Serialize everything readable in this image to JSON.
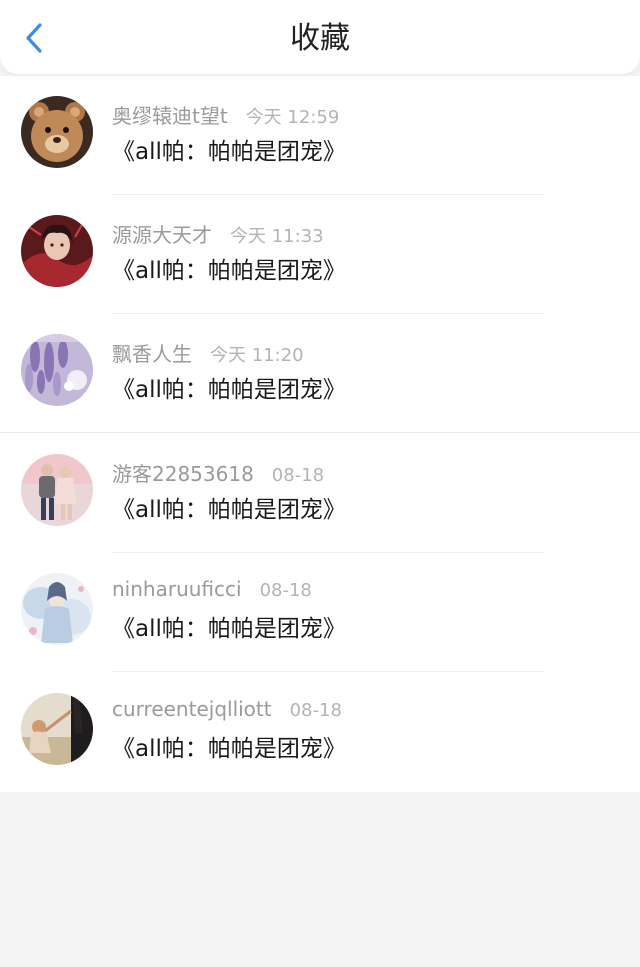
{
  "header": {
    "title": "收藏",
    "back_icon": "chevron-left-icon",
    "accent_color": "#3a8ee6"
  },
  "favorites": [
    {
      "username": "奥缪辕迪t望t",
      "time": "今天 12:59",
      "content": "《all帕：帕帕是团宠》",
      "avatar": "teddy-bear-avatar"
    },
    {
      "username": "源源大天才",
      "time": "今天 11:33",
      "content": "《all帕：帕帕是团宠》",
      "avatar": "anime-character-avatar"
    },
    {
      "username": "飘香人生",
      "time": "今天 11:20",
      "content": "《all帕：帕帕是团宠》",
      "avatar": "wisteria-flowers-avatar"
    },
    {
      "username": "游客22853618",
      "time": "08-18",
      "content": "《all帕：帕帕是团宠》",
      "avatar": "couple-photo-avatar"
    },
    {
      "username": "ninharuuficci",
      "time": "08-18",
      "content": "《all帕：帕帕是团宠》",
      "avatar": "watercolor-illustration-avatar"
    },
    {
      "username": "curreentejqlliott",
      "time": "08-18",
      "content": "《all帕：帕帕是团宠》",
      "avatar": "beach-photo-avatar"
    }
  ]
}
